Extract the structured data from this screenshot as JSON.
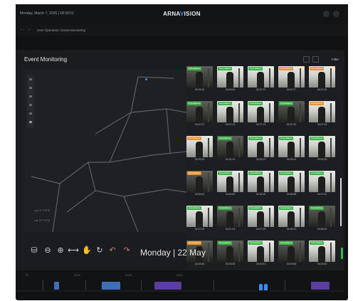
{
  "header": {
    "datetime": "Monday, March 7, 2025 | 18:30:51",
    "brand_prefix": "ARNA",
    "brand_accent": "V",
    "brand_suffix": "ISION"
  },
  "breadcrumb": {
    "back": "←",
    "forward": "→",
    "path": "User Operation  /  Event Monitoring"
  },
  "page": {
    "title": "Event Monitoring",
    "filter_label": "Filter"
  },
  "map": {
    "lat": "Lat: 37°7'22\"E",
    "lon": "Lat: 37°7'22\"E"
  },
  "colors": {
    "accent": "#3b8df0",
    "badge_green": "#3cb54a",
    "badge_orange": "#f0922b",
    "timeline_blue": "#3f6fb5",
    "timeline_purple": "#5a3fa0"
  },
  "events": [
    {
      "time": "04:35:24",
      "badge": "Surveillance",
      "badge_color": "#3cb54a",
      "tone": "dark"
    },
    {
      "time": "04:36:04",
      "badge": "Surveillance",
      "badge_color": "#3cb54a",
      "tone": "light"
    },
    {
      "time": "04:37:22",
      "badge": "Surveillance",
      "badge_color": "#3cb54a",
      "tone": "light"
    },
    {
      "time": "04:37:27",
      "badge": "Surveillance",
      "badge_color": "#f0922b",
      "tone": "light"
    },
    {
      "time": "04:37:33",
      "badge": "Surveillance",
      "badge_color": "#f0922b",
      "tone": "light"
    },
    {
      "time": "04:37:37",
      "badge": "Surveillance",
      "badge_color": "#3cb54a",
      "tone": "dark"
    },
    {
      "time": "04:37:13",
      "badge": "Surveillance",
      "badge_color": "#3cb54a",
      "tone": "light"
    },
    {
      "time": "04:37:13",
      "badge": "Surveillance",
      "badge_color": "#3cb54a",
      "tone": "light"
    },
    {
      "time": "04:37:30",
      "badge": "Surveillance",
      "badge_color": "#3cb54a",
      "tone": "dark"
    },
    {
      "time": "04:37:18",
      "badge": "Surveillance",
      "badge_color": "#f0922b",
      "tone": "light"
    },
    {
      "time": "04:35:45",
      "badge": "Surveillance",
      "badge_color": "#f0922b",
      "tone": "light"
    },
    {
      "time": "04:34:15",
      "badge": "Surveillance",
      "badge_color": "#3cb54a",
      "tone": "dark"
    },
    {
      "time": "04:35:19",
      "badge": "Surveillance",
      "badge_color": "#3cb54a",
      "tone": "light"
    },
    {
      "time": "04:35:15",
      "badge": "Surveillance",
      "badge_color": "#3cb54a",
      "tone": "light"
    },
    {
      "time": "04:35:36",
      "badge": "Surveillance",
      "badge_color": "#3cb54a",
      "tone": "light"
    },
    {
      "time": "04:36:02",
      "badge": "Surveillance",
      "badge_color": "#f0922b",
      "tone": "dark"
    },
    {
      "time": "04:36:32",
      "badge": "Surveillance",
      "badge_color": "#3cb54a",
      "tone": "light"
    },
    {
      "time": "04:36:35",
      "badge": "Surveillance",
      "badge_color": "#3cb54a",
      "tone": "light"
    },
    {
      "time": "04:36:58",
      "badge": "Surveillance",
      "badge_color": "#3cb54a",
      "tone": "light"
    },
    {
      "time": "04:37:02",
      "badge": "Surveillance",
      "badge_color": "#3cb54a",
      "tone": "light"
    },
    {
      "time": "04:37:09",
      "badge": "Surveillance",
      "badge_color": "#3cb54a",
      "tone": "light"
    },
    {
      "time": "04:37:23",
      "badge": "Surveillance",
      "badge_color": "#3cb54a",
      "tone": "dark"
    },
    {
      "time": "04:37:39",
      "badge": "Surveillance",
      "badge_color": "#3cb54a",
      "tone": "light"
    },
    {
      "time": "04:38:20",
      "badge": "Surveillance",
      "badge_color": "#3cb54a",
      "tone": "light"
    },
    {
      "time": "04:38:42",
      "badge": "Surveillance",
      "badge_color": "#3cb54a",
      "tone": "dark"
    },
    {
      "time": "04:39:20",
      "badge": "Surveillance",
      "badge_color": "#f0922b",
      "tone": "dark"
    },
    {
      "time": "04:39:38",
      "badge": "Surveillance",
      "badge_color": "#3cb54a",
      "tone": "dark"
    },
    {
      "time": "04:39:41",
      "badge": "Surveillance",
      "badge_color": "#3cb54a",
      "tone": "light"
    },
    {
      "time": "04:39:58",
      "badge": "Surveillance",
      "badge_color": "#3cb54a",
      "tone": "dark"
    },
    {
      "time": "04:40:00",
      "badge": "Surveillance",
      "badge_color": "#3cb54a",
      "tone": "light"
    }
  ],
  "playback": {
    "date_label": "Monday | 22 May",
    "icons": [
      "layers-icon",
      "zoom-out-icon",
      "zoom-in-icon",
      "fit-width-icon",
      "pan-hand-icon",
      "rotate-icon",
      "undo-icon",
      "redo-icon"
    ]
  },
  "timeline": {
    "ticks": [
      "00",
      "02:00",
      "03:00",
      "04:00"
    ]
  }
}
